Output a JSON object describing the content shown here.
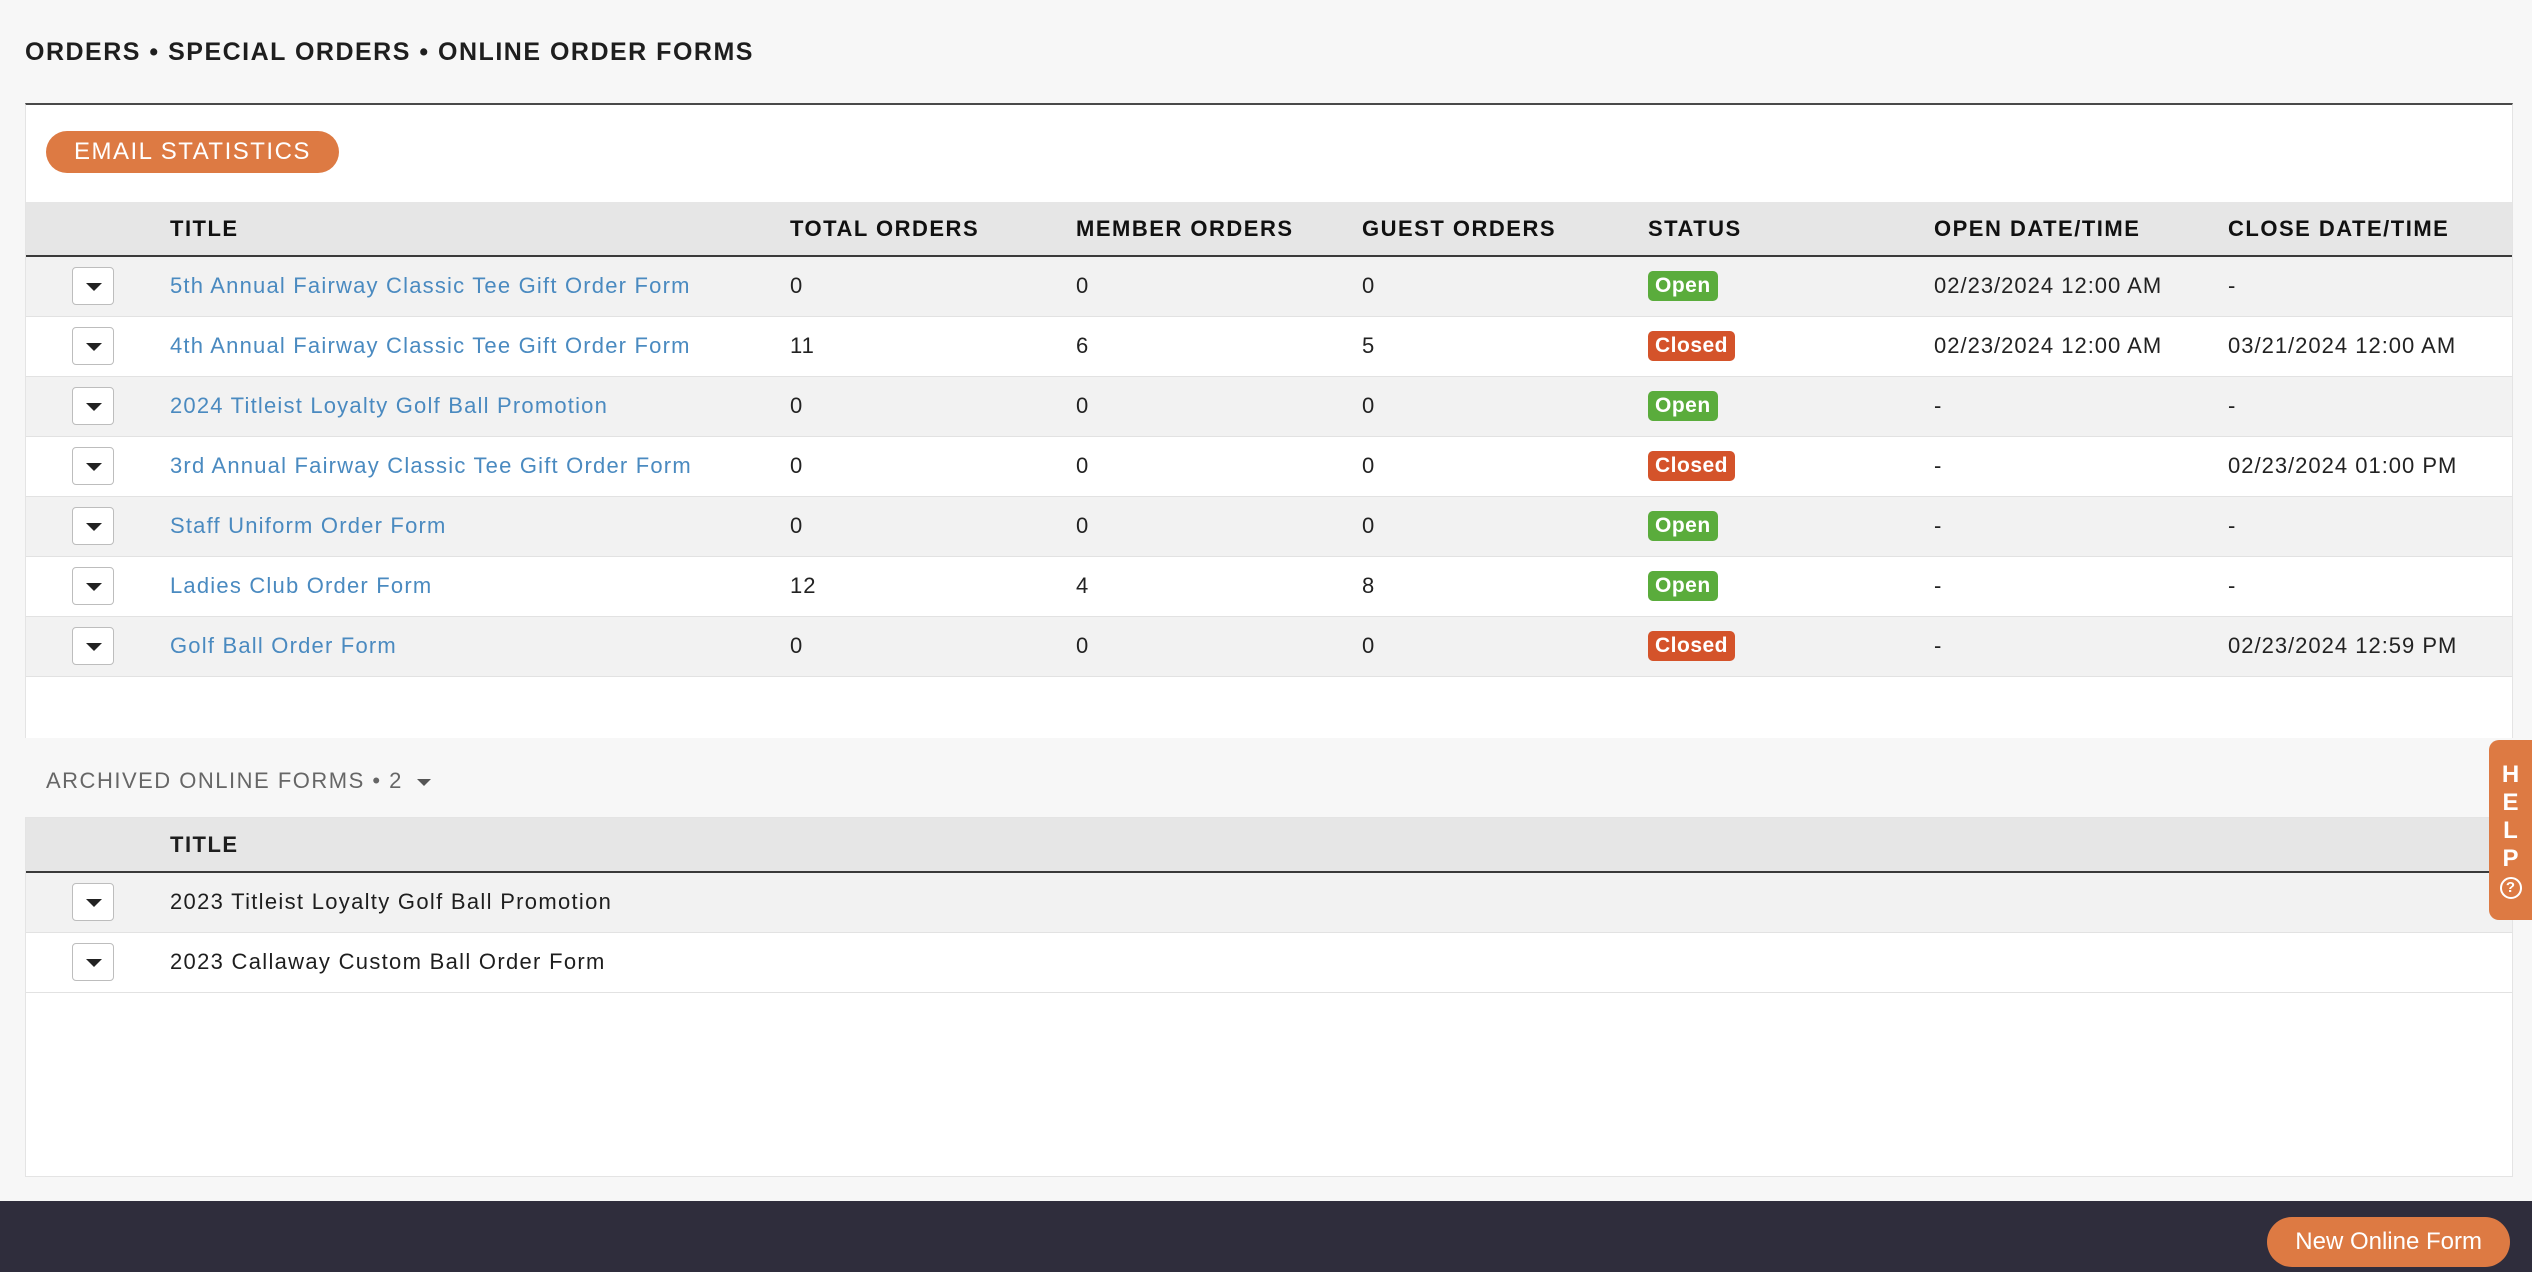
{
  "breadcrumb": "ORDERS • SPECIAL ORDERS • ONLINE ORDER FORMS",
  "toolbar": {
    "email_stats_label": "EMAIL STATISTICS"
  },
  "table": {
    "headers": {
      "title": "TITLE",
      "total": "TOTAL ORDERS",
      "member": "MEMBER ORDERS",
      "guest": "GUEST ORDERS",
      "status": "STATUS",
      "open": "OPEN DATE/TIME",
      "close": "CLOSE DATE/TIME"
    },
    "rows": [
      {
        "title": "5th Annual Fairway Classic Tee Gift Order Form",
        "total": "0",
        "member": "0",
        "guest": "0",
        "status": "Open",
        "open": "02/23/2024 12:00 AM",
        "close": "-"
      },
      {
        "title": "4th Annual Fairway Classic Tee Gift Order Form",
        "total": "11",
        "member": "6",
        "guest": "5",
        "status": "Closed",
        "open": "02/23/2024 12:00 AM",
        "close": "03/21/2024 12:00 AM"
      },
      {
        "title": "2024 Titleist Loyalty Golf Ball Promotion",
        "total": "0",
        "member": "0",
        "guest": "0",
        "status": "Open",
        "open": "-",
        "close": "-"
      },
      {
        "title": "3rd Annual Fairway Classic Tee Gift Order Form",
        "total": "0",
        "member": "0",
        "guest": "0",
        "status": "Closed",
        "open": "-",
        "close": "02/23/2024 01:00 PM"
      },
      {
        "title": "Staff Uniform Order Form",
        "total": "0",
        "member": "0",
        "guest": "0",
        "status": "Open",
        "open": "-",
        "close": "-"
      },
      {
        "title": "Ladies Club Order Form",
        "total": "12",
        "member": "4",
        "guest": "8",
        "status": "Open",
        "open": "-",
        "close": "-"
      },
      {
        "title": "Golf Ball Order Form",
        "total": "0",
        "member": "0",
        "guest": "0",
        "status": "Closed",
        "open": "-",
        "close": "02/23/2024 12:59 PM"
      }
    ]
  },
  "archived": {
    "label": "ARCHIVED ONLINE FORMS • 2",
    "header_title": "TITLE",
    "rows": [
      {
        "title": "2023 Titleist Loyalty Golf Ball Promotion"
      },
      {
        "title": "2023 Callaway Custom Ball Order Form"
      }
    ]
  },
  "help": {
    "letters": [
      "H",
      "E",
      "L",
      "P"
    ],
    "icon": "question-circle-icon",
    "glyph": "?"
  },
  "footer": {
    "new_form_label": "New Online Form"
  },
  "colors": {
    "accent": "#dd7a43",
    "open": "#5aac3c",
    "closed": "#d4532a",
    "link": "#4a8ac0",
    "footer": "#2f2d3c"
  },
  "icons": {
    "row_menu": "chevron-down-icon"
  }
}
